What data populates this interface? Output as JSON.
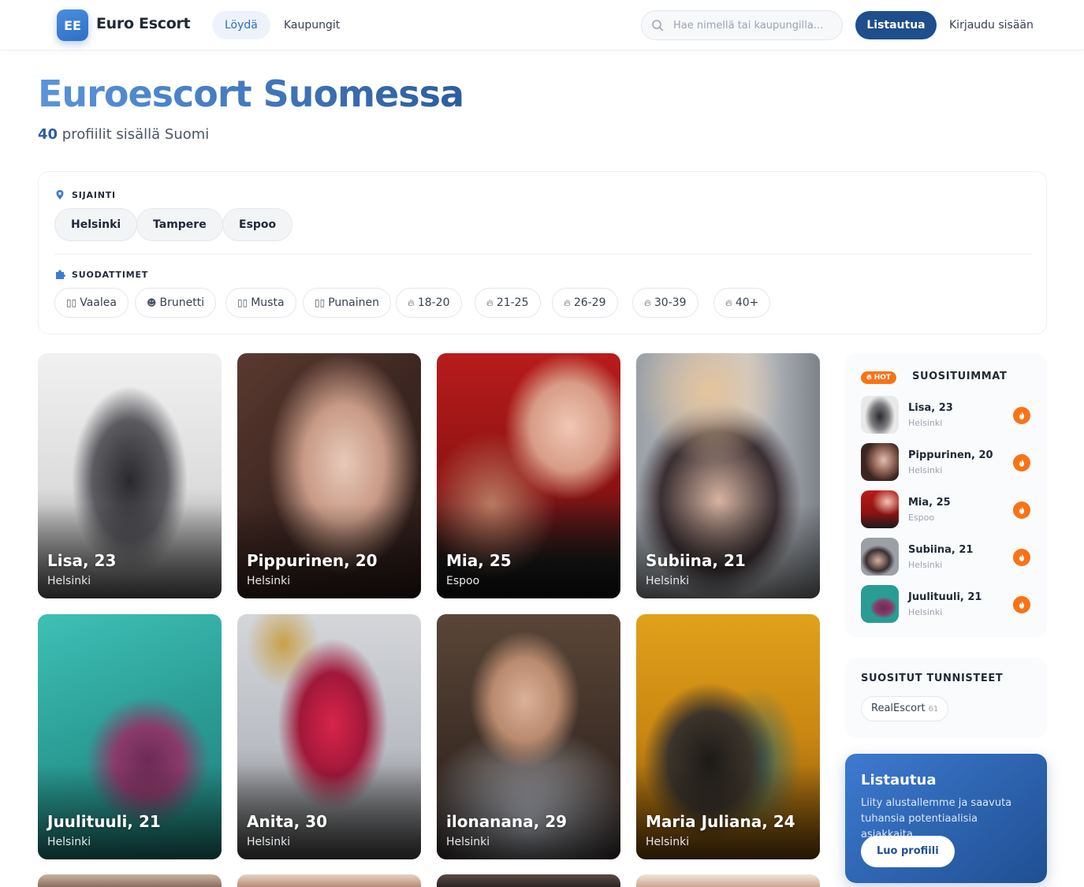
{
  "header": {
    "logo": "EE",
    "brand": "Euro Escort",
    "nav": [
      "Löydä",
      "Kaupungit"
    ],
    "search_placeholder": "Hae nimellä tai kaupungilla...",
    "signup": "Listautua",
    "login": "Kirjaudu sisään"
  },
  "page": {
    "title": "Euroescort Suomessa",
    "count": "40",
    "subtitle_rest": "profiilit sisällä Suomi"
  },
  "filters": {
    "location_label": "SIJAINTI",
    "cities": [
      "Helsinki",
      "Tampere",
      "Espoo"
    ],
    "filters_label": "SUODATTIMET",
    "chips": [
      "Vaalea",
      "Brunetti",
      "Musta",
      "Punainen",
      "18-20",
      "21-25",
      "26-29",
      "30-39",
      "40+"
    ]
  },
  "profiles": [
    {
      "name": "Lisa, 23",
      "city": "Helsinki"
    },
    {
      "name": "Pippurinen, 20",
      "city": "Helsinki"
    },
    {
      "name": "Mia, 25",
      "city": "Espoo"
    },
    {
      "name": "Subiina, 21",
      "city": "Helsinki"
    },
    {
      "name": "Juulituuli, 21",
      "city": "Helsinki"
    },
    {
      "name": "Anita, 30",
      "city": "Helsinki"
    },
    {
      "name": "ilonanana, 29",
      "city": "Helsinki"
    },
    {
      "name": "Maria Juliana, 24",
      "city": "Helsinki"
    }
  ],
  "sidebar": {
    "hot_badge": "HOT",
    "popular_title": "SUOSITUIMMAT",
    "popular": [
      {
        "name": "Lisa, 23",
        "city": "Helsinki"
      },
      {
        "name": "Pippurinen, 20",
        "city": "Helsinki"
      },
      {
        "name": "Mia, 25",
        "city": "Espoo"
      },
      {
        "name": "Subiina, 21",
        "city": "Helsinki"
      },
      {
        "name": "Juulituuli, 21",
        "city": "Helsinki"
      }
    ],
    "tags_title": "SUOSITUT TUNNISTEET",
    "tag": {
      "name": "RealEscort",
      "count": "61"
    },
    "cta_title": "Listautua",
    "cta_text": "Liity alustallemme ja saavuta tuhansia potentiaalisia asiakkaita.",
    "cta_button": "Luo profiili"
  },
  "colors": {
    "accent": "#2f6fc6",
    "primary_dark": "#1e4e8c",
    "hot": "#f97316"
  }
}
